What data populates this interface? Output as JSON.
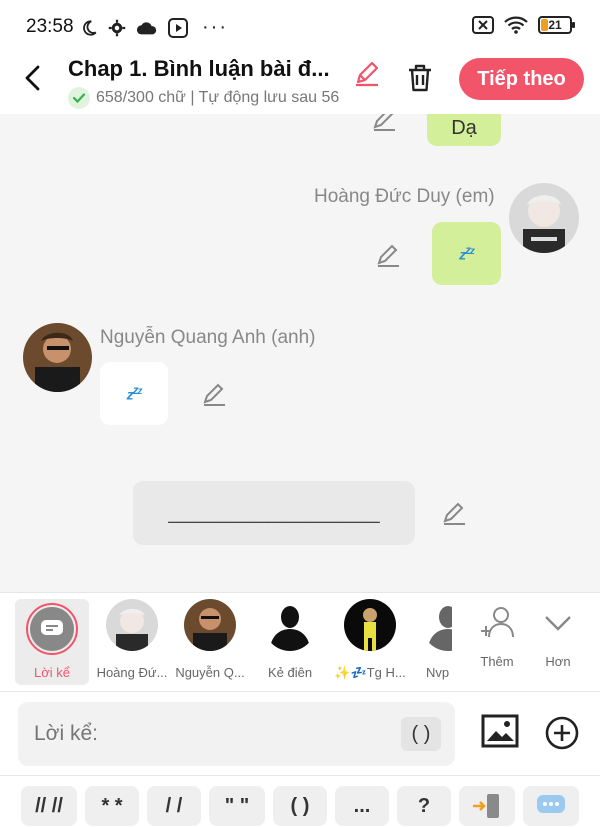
{
  "status_bar": {
    "time": "23:58",
    "battery": "21"
  },
  "header": {
    "title": "Chap 1. Bình luận bài đ...",
    "subtitle": "658/300 chữ | Tự động lưu sau 56",
    "next_label": "Tiếp theo",
    "accent": "#f2546a"
  },
  "chat": {
    "msg1_text": "Dạ",
    "msg2_speaker": "Hoàng Đức Duy (em)",
    "msg3_speaker": "Nguyễn Quang Anh (anh)",
    "msg4_text": "___________________",
    "bubble_green": "#d4ef9a"
  },
  "characters": {
    "items": [
      {
        "label": "Lời kể",
        "selected": true
      },
      {
        "label": "Hoàng Đứ..."
      },
      {
        "label": "Nguyễn Q..."
      },
      {
        "label": "Kẻ điên"
      },
      {
        "label": "✨💤Tg H..."
      },
      {
        "label": "Nvp"
      }
    ],
    "more_label": "Thêm",
    "expand_label": "Hơn"
  },
  "input": {
    "placeholder": "Lời kể:",
    "paren_label": "( )"
  },
  "symbols": [
    "// //",
    "* *",
    "/ /",
    "\" \"",
    "( )",
    "...",
    "?"
  ]
}
